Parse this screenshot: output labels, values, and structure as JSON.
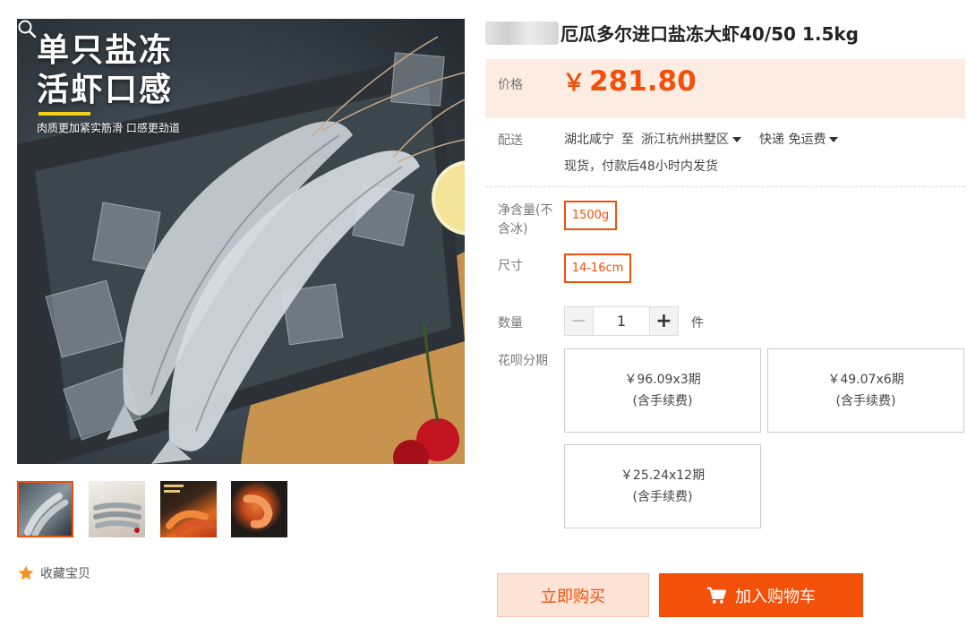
{
  "gallery": {
    "promo_line1": "单只盐冻",
    "promo_line2": "活虾口感",
    "promo_sub": "肉质更加紧实筋滑 口感更劲道",
    "thumbnails": [
      "thumb-raw-shrimp",
      "thumb-shrimp-plate",
      "thumb-cooked-shrimp",
      "thumb-single-shrimp"
    ],
    "active_thumbnail": 1,
    "favorite_label": "收藏宝贝"
  },
  "product": {
    "title": "厄瓜多尔进口盐冻大虾40/50 1.5kg",
    "price_label": "价格",
    "currency": "￥",
    "price": "281.80"
  },
  "shipping": {
    "label": "配送",
    "from": "湖北咸宁",
    "to_word": "至",
    "to": "浙江杭州拱墅区",
    "method": "快递 免运费",
    "note": "现货，付款后48小时内发货"
  },
  "options": {
    "net_weight_label": "净含量(不含冰)",
    "net_weight_value": "1500g",
    "size_label": "尺寸",
    "size_value": "14-16cm",
    "quantity_label": "数量",
    "quantity_value": "1",
    "quantity_unit": "件",
    "minus_symbol": "−",
    "plus_symbol": "+"
  },
  "installments": {
    "label": "花呗分期",
    "plans": [
      {
        "amount": "￥96.09x3期",
        "fee": "(含手续费)"
      },
      {
        "amount": "￥49.07x6期",
        "fee": "(含手续费)"
      },
      {
        "amount": "￥25.24x12期",
        "fee": "(含手续费)"
      }
    ]
  },
  "actions": {
    "buy_now": "立即购买",
    "add_to_cart": "加入购物车"
  },
  "colors": {
    "accent": "#f3500a",
    "price_bg": "#fcece1",
    "highlight": "#f3d01b"
  }
}
